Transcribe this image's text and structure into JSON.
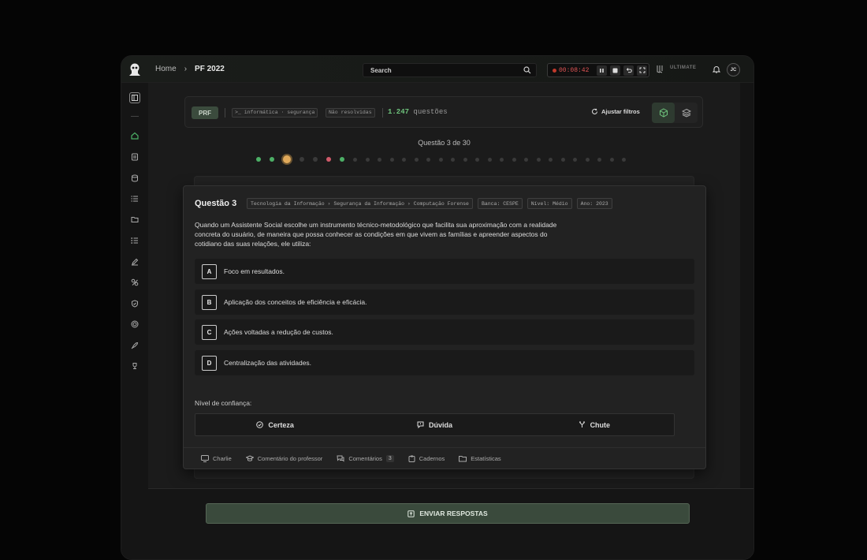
{
  "colors": {
    "accent_green": "#4caf66",
    "accent_red": "#d05a6a",
    "current_orange": "#e0a95a",
    "timer_red": "#e05555"
  },
  "breadcrumb": {
    "home": "Home",
    "separator": "›",
    "current": "PF 2022"
  },
  "search": {
    "label": "Search"
  },
  "timer": {
    "value": "00:08:42"
  },
  "brand": {
    "tier": "ULTIMATE"
  },
  "user": {
    "initials": "JC"
  },
  "sidebar": {
    "icons": [
      "panel-icon",
      "home-icon",
      "document-icon",
      "database-icon",
      "list-icon",
      "folder-icon",
      "list-check-icon",
      "pen-icon",
      "analytics-icon",
      "shield-icon",
      "target-icon",
      "rocket-icon",
      "trophy-icon"
    ]
  },
  "filters": {
    "org": "PRF",
    "topic": ">_ informática · segurança",
    "status": "Não resolvidas",
    "count_value": "1.247",
    "count_unit": "questões",
    "adjust_label": "Ajustar filtros"
  },
  "progress": {
    "label": "Questão 3 de 30",
    "current": 3,
    "total": 30,
    "states": [
      "answered",
      "answered",
      "current",
      "unanswered",
      "unanswered",
      "wrong",
      "answered",
      "unanswered",
      "unanswered",
      "unanswered",
      "unanswered",
      "unanswered",
      "unanswered",
      "unanswered",
      "unanswered",
      "unanswered",
      "unanswered",
      "unanswered",
      "unanswered",
      "unanswered",
      "unanswered",
      "unanswered",
      "unanswered",
      "unanswered",
      "unanswered",
      "unanswered",
      "unanswered",
      "unanswered",
      "unanswered",
      "unanswered"
    ]
  },
  "question": {
    "title": "Questão 3",
    "tags": [
      "Tecnologia da Informação › Segurança da Informação › Computação Forense",
      "Banca: CESPE",
      "Nível: Médio",
      "Ano: 2023"
    ],
    "statement": "Quando um Assistente Social escolhe um instrumento técnico-metodológico que facilita sua aproximação com a realidade concreta do usuário, de maneira que possa conhecer as condições em que vivem as famílias e apreender aspectos do cotidiano das suas relações, ele utiliza:",
    "options": [
      {
        "letter": "A",
        "text": "Foco em resultados."
      },
      {
        "letter": "B",
        "text": "Aplicação dos conceitos de eficiência e eficácia."
      },
      {
        "letter": "C",
        "text": "Ações voltadas a redução de custos."
      },
      {
        "letter": "D",
        "text": "Centralização das atividades."
      }
    ],
    "confidence_label": "Nível de confiança:",
    "confidence": [
      "Certeza",
      "Dúvida",
      "Chute"
    ]
  },
  "footer": {
    "charlie": "Charlie",
    "teacher_comment": "Comentário do professor",
    "comments": "Comentários",
    "comments_count": "3",
    "notebooks": "Cadernos",
    "stats": "Estatísticas"
  },
  "submit": {
    "label": "ENVIAR RESPOSTAS"
  }
}
